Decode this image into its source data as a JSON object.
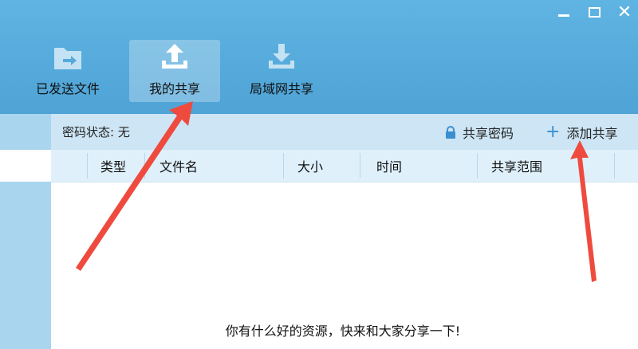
{
  "toolbar": {
    "items": [
      {
        "label": "已发送文件",
        "icon": "folder-send-icon"
      },
      {
        "label": "我的共享",
        "icon": "upload-icon"
      },
      {
        "label": "局域网共享",
        "icon": "download-icon"
      }
    ]
  },
  "status": {
    "password_status": "密码状态: 无",
    "share_password_label": "共享密码",
    "add_share_label": "添加共享"
  },
  "table": {
    "columns": [
      "类型",
      "文件名",
      "大小",
      "时间",
      "共享范围"
    ]
  },
  "empty_message": "你有什么好的资源，快来和大家分享一下!",
  "window_controls": [
    "minimize-icon",
    "maximize-icon",
    "close-icon"
  ],
  "colors": {
    "header": "#55aadb",
    "status_bar": "#cde5f4",
    "table_header": "#dff0fb",
    "arrow": "#ee4b3e"
  }
}
